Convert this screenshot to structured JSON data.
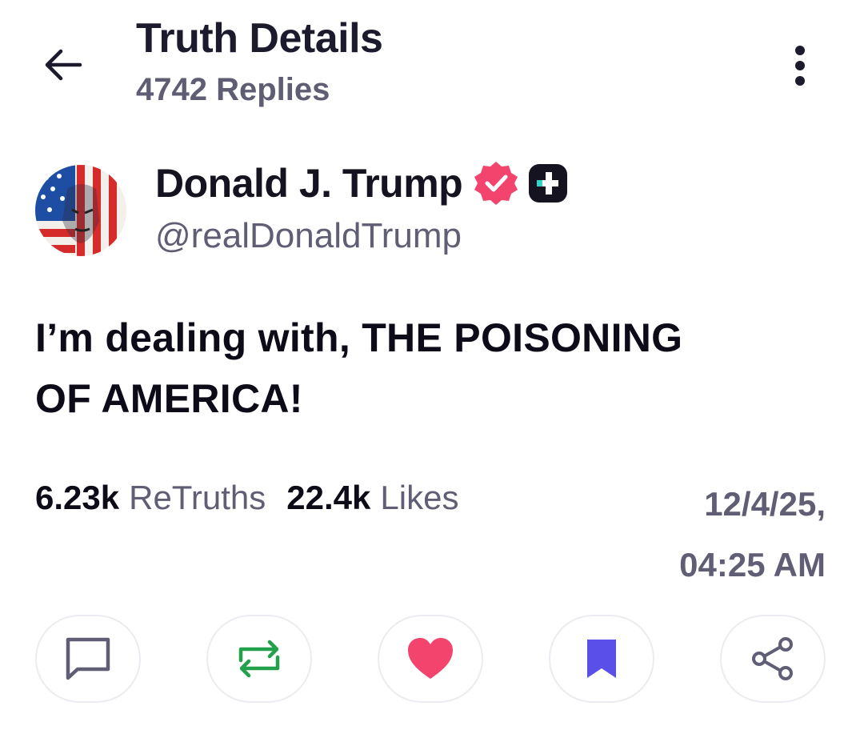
{
  "header": {
    "title": "Truth Details",
    "replies": "4742 Replies",
    "back_icon": "arrow-left-icon",
    "more_icon": "vertical-dots-icon"
  },
  "author": {
    "name": "Donald J. Trump",
    "handle": "@realDonaldTrump",
    "verified_color": "#f2446d",
    "avatar": "flag-portrait-avatar"
  },
  "post": {
    "text_line1": "I’m dealing with, THE POISONING",
    "text_line2": "OF AMERICA!"
  },
  "stats": {
    "retruths_count": "6.23k",
    "retruths_label": "ReTruths",
    "likes_count": "22.4k",
    "likes_label": "Likes",
    "date": "12/4/25,",
    "time": "04:25 AM"
  },
  "actions": {
    "reply_icon": "comment-icon",
    "retruth_icon": "retruth-icon",
    "retruth_color": "#22a04b",
    "like_icon": "heart-icon",
    "like_color": "#f2446d",
    "bookmark_icon": "bookmark-icon",
    "bookmark_color": "#5b4fe9",
    "share_icon": "share-icon"
  }
}
